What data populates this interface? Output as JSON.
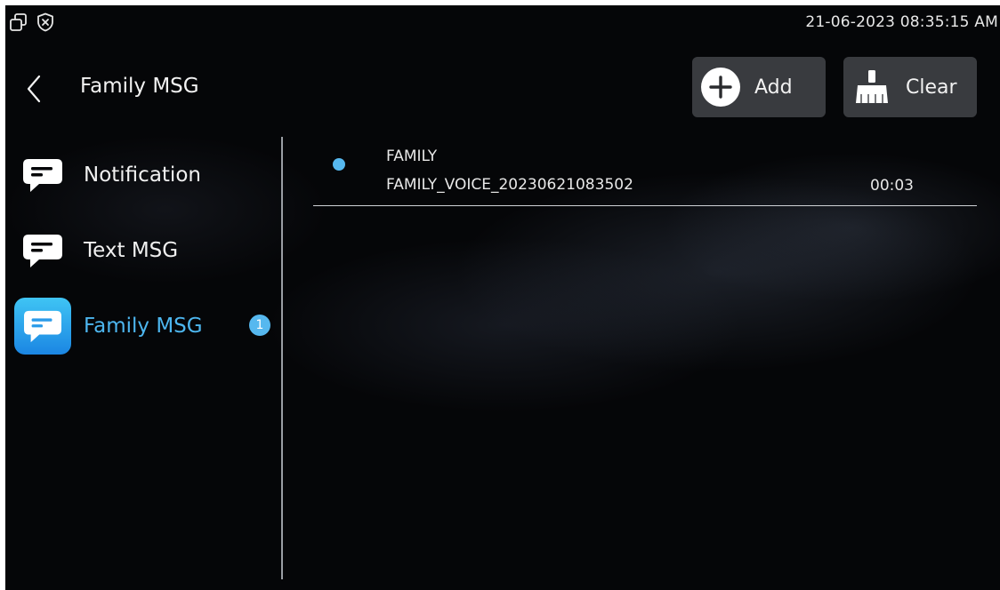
{
  "status_bar": {
    "datetime": "21-06-2023 08:35:15 AM",
    "icons": [
      "window-restore-icon",
      "shield-close-icon"
    ]
  },
  "header": {
    "title": "Family MSG",
    "add_label": "Add",
    "clear_label": "Clear"
  },
  "sidebar": {
    "items": [
      {
        "label": "Notification",
        "icon": "message-icon",
        "active": false
      },
      {
        "label": "Text MSG",
        "icon": "message-icon",
        "active": false
      },
      {
        "label": "Family MSG",
        "icon": "message-icon",
        "active": true,
        "badge": "1"
      }
    ]
  },
  "messages": [
    {
      "sender": "FAMILY",
      "file": "FAMILY_VOICE_20230621083502",
      "duration": "00:03",
      "unread": true
    }
  ],
  "colors": {
    "accent": "#4db6ef",
    "button_bg": "#3e4044",
    "background": "#050608"
  }
}
